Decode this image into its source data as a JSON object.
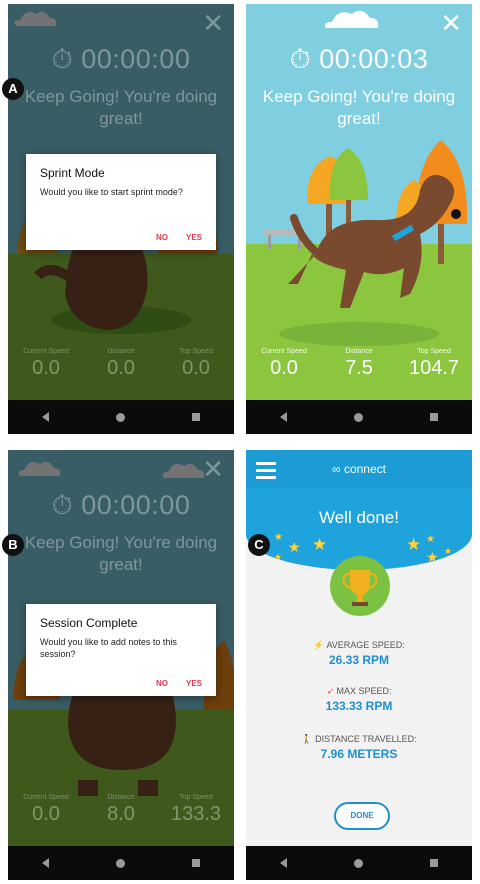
{
  "panels": [
    {
      "timer": "00:00:00",
      "message": "Keep Going! You're doing great!",
      "stats": [
        {
          "label": "Current Speed",
          "value": "0.0"
        },
        {
          "label": "Distance",
          "value": "0.0"
        },
        {
          "label": "Top Speed",
          "value": "0.0"
        }
      ],
      "dialog": {
        "title": "Sprint Mode",
        "message": "Would you like to start sprint mode?",
        "no": "NO",
        "yes": "YES"
      },
      "badge": "A"
    },
    {
      "timer": "00:00:03",
      "message": "Keep Going! You're doing great!",
      "stats": [
        {
          "label": "Current Speed",
          "value": "0.0"
        },
        {
          "label": "Distance",
          "value": "7.5"
        },
        {
          "label": "Top Speed",
          "value": "104.7"
        }
      ]
    },
    {
      "timer": "00:00:00",
      "message": "Keep Going! You're doing great!",
      "stats": [
        {
          "label": "Current Speed",
          "value": "0.0"
        },
        {
          "label": "Distance",
          "value": "8.0"
        },
        {
          "label": "Top Speed",
          "value": "133.3"
        }
      ],
      "dialog": {
        "title": "Session Complete",
        "message": "Would you like to add notes to this session?",
        "no": "NO",
        "yes": "YES"
      },
      "badge": "B"
    }
  ],
  "summary": {
    "badge": "C",
    "brand": "connect",
    "title": "Well done!",
    "metrics": [
      {
        "label": "AVERAGE SPEED:",
        "value": "26.33 RPM"
      },
      {
        "label": "MAX SPEED:",
        "value": "133.33 RPM"
      },
      {
        "label": "DISTANCE TRAVELLED:",
        "value": "7.96 METERS"
      }
    ],
    "done": "DONE"
  },
  "colors": {
    "sky": "#7fcfe0",
    "grass": "#8cc63f",
    "accent": "#e53950",
    "connect_blue": "#1fa3dc",
    "value_blue": "#1f8fd0"
  }
}
